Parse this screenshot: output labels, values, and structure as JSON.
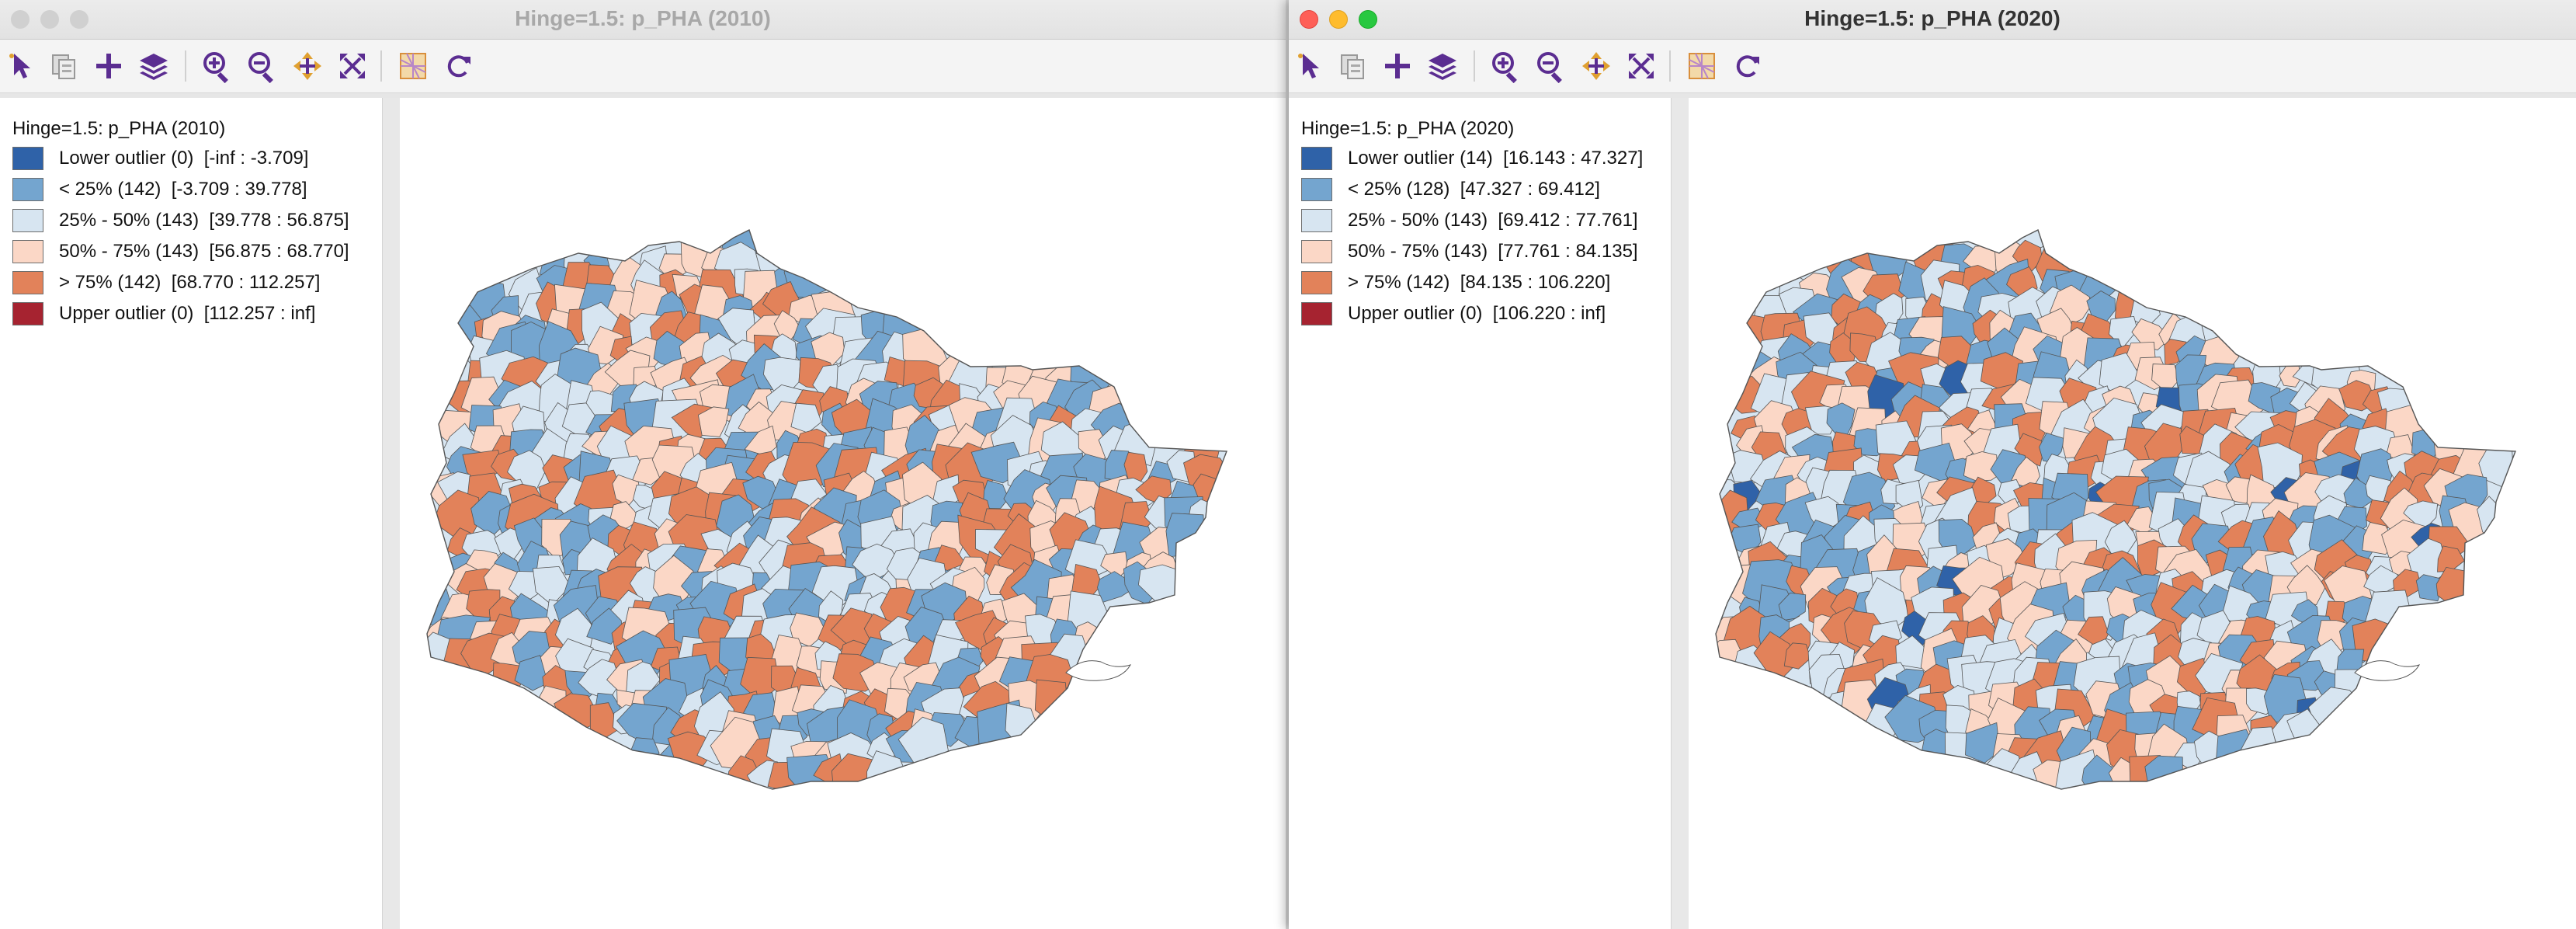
{
  "colors": {
    "lower_outlier": "#2f62a8",
    "q1": "#74a5cf",
    "q2": "#d7e5f1",
    "q3": "#fbd7c6",
    "q4": "#e2825a",
    "upper_outlier": "#a62330",
    "map_border": "#555555",
    "toolbar_icon": "#5b2d91"
  },
  "toolbar_icons": [
    "select-pointer-icon",
    "copy-icon",
    "add-icon",
    "layers-icon",
    "zoom-in-icon",
    "zoom-out-icon",
    "pan-icon",
    "fit-extent-icon",
    "basemap-icon",
    "refresh-icon"
  ],
  "windows": [
    {
      "title": "Hinge=1.5: p_PHA (2010)",
      "active": false,
      "legend_title": "Hinge=1.5: p_PHA (2010)",
      "legend": [
        {
          "label": "Lower outlier (0)  [-inf : -3.709]",
          "color_key": "lower_outlier"
        },
        {
          "label": "< 25% (142)  [-3.709 : 39.778]",
          "color_key": "q1"
        },
        {
          "label": "25% - 50% (143)  [39.778 : 56.875]",
          "color_key": "q2"
        },
        {
          "label": "50% - 75% (143)  [56.875 : 68.770]",
          "color_key": "q3"
        },
        {
          "label": "> 75% (142)  [68.770 : 112.257]",
          "color_key": "q4"
        },
        {
          "label": "Upper outlier (0)  [112.257 : inf]",
          "color_key": "upper_outlier"
        }
      ],
      "map_mix": {
        "lower_outlier": 0,
        "q1": 142,
        "q2": 143,
        "q3": 143,
        "q4": 142,
        "upper_outlier": 0
      }
    },
    {
      "title": "Hinge=1.5: p_PHA (2020)",
      "active": true,
      "legend_title": "Hinge=1.5: p_PHA (2020)",
      "legend": [
        {
          "label": "Lower outlier (14)  [16.143 : 47.327]",
          "color_key": "lower_outlier"
        },
        {
          "label": "< 25% (128)  [47.327 : 69.412]",
          "color_key": "q1"
        },
        {
          "label": "25% - 50% (143)  [69.412 : 77.761]",
          "color_key": "q2"
        },
        {
          "label": "50% - 75% (143)  [77.761 : 84.135]",
          "color_key": "q3"
        },
        {
          "label": "> 75% (142)  [84.135 : 106.220]",
          "color_key": "q4"
        },
        {
          "label": "Upper outlier (0)  [106.220 : inf]",
          "color_key": "upper_outlier"
        }
      ],
      "map_mix": {
        "lower_outlier": 14,
        "q1": 128,
        "q2": 143,
        "q3": 143,
        "q4": 142,
        "upper_outlier": 0
      }
    }
  ]
}
